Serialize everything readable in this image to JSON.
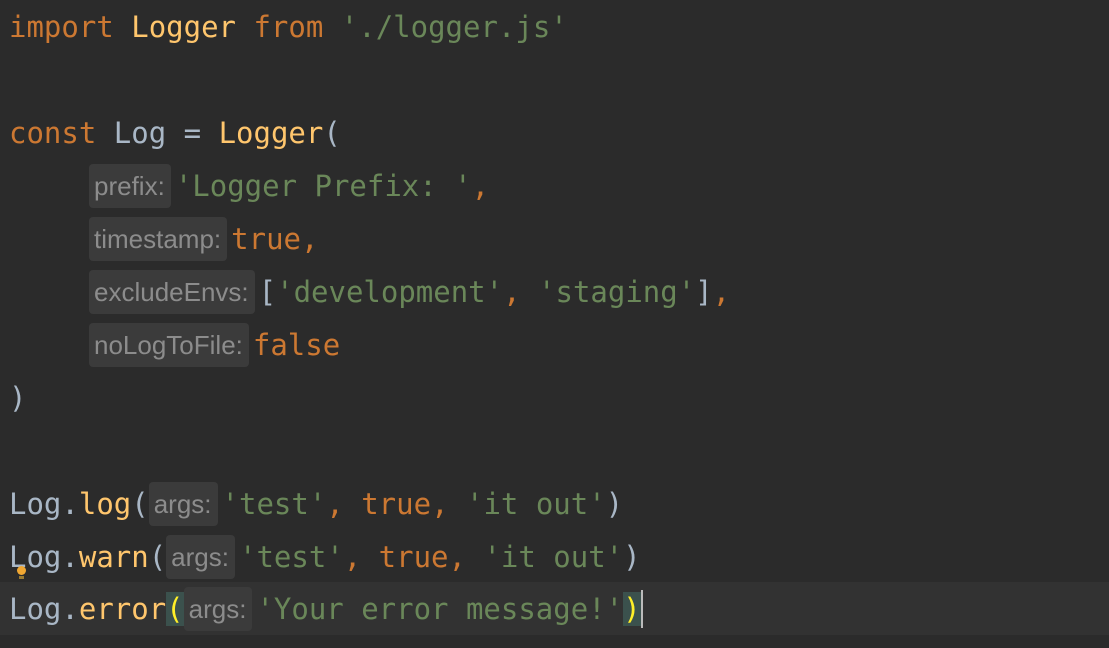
{
  "code": {
    "line1": {
      "import": "import",
      "name": "Logger",
      "from": "from",
      "path": "'./logger.js'"
    },
    "line3": {
      "const": "const",
      "var": "Log",
      "eq": " = ",
      "fn": "Logger",
      "open": "("
    },
    "args": [
      {
        "hint": "prefix:",
        "value": "'Logger Prefix: '",
        "trail": ","
      },
      {
        "hint": "timestamp:",
        "value": "true",
        "trail": ","
      },
      {
        "hint": "excludeEnvs:",
        "open": "[",
        "v1": "'development'",
        "sep": ", ",
        "v2": "'staging'",
        "close": "]",
        "trail": ","
      },
      {
        "hint": "noLogToFile:",
        "value": "false"
      }
    ],
    "close_paren": ")",
    "calls": [
      {
        "obj": "Log",
        "dot": ".",
        "method": "log",
        "open": "(",
        "hint": "args:",
        "a1": "'test'",
        "sep1": ", ",
        "a2": "true",
        "sep2": ", ",
        "a3": "'it out'",
        "close": ")"
      },
      {
        "obj": "Log",
        "dot": ".",
        "method": "warn",
        "open": "(",
        "hint": "args:",
        "a1": "'test'",
        "sep1": ", ",
        "a2": "true",
        "sep2": ", ",
        "a3": "'it out'",
        "close": ")"
      },
      {
        "obj": "Log",
        "dot": ".",
        "method": "error",
        "open": "(",
        "hint": "args:",
        "a1": "'Your error message!'",
        "close": ")"
      }
    ]
  },
  "colors": {
    "background": "#2b2b2b",
    "keyword": "#cc7832",
    "function": "#ffc66d",
    "string": "#6a8759",
    "text": "#a9b7c6"
  }
}
